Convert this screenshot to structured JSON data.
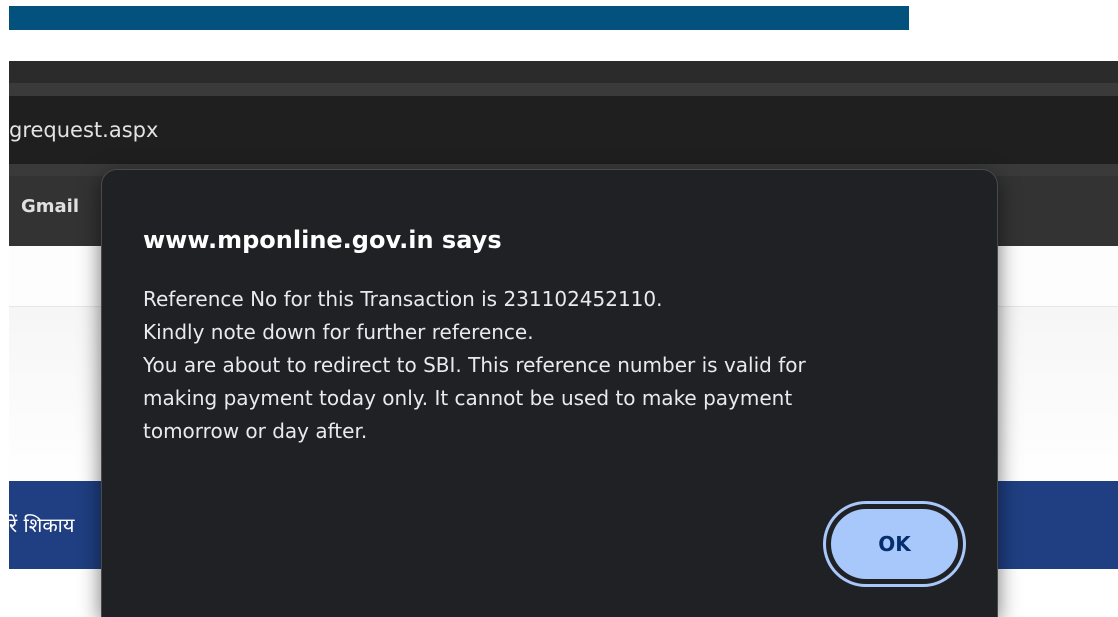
{
  "browser": {
    "address_text": "grequest.aspx",
    "bookmarks": {
      "gmail_label": "Gmail"
    }
  },
  "page": {
    "nav_text": "रें  शिकाय"
  },
  "dialog": {
    "title": "www.mponline.gov.in says",
    "message_lines": [
      "Reference No for this Transaction is 231102452110.",
      "Kindly note down for further reference.",
      "You are about to redirect to SBI. This reference number is valid for",
      "making payment today only. It cannot be used to make payment",
      "tomorrow or day after."
    ],
    "ok_label": "OK"
  },
  "colors": {
    "banner": "#03517d",
    "nav_band": "#1f3f82",
    "dialog_bg": "#202124",
    "ok_button": "#a8c7fa"
  }
}
